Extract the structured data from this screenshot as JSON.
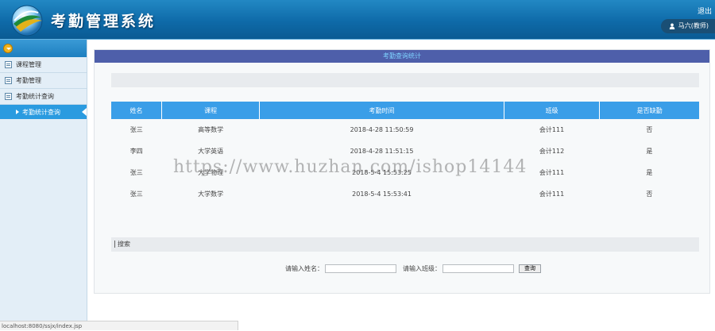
{
  "header": {
    "title": "考勤管理系统",
    "logout_label": "退出",
    "user_label": "马六(教师)"
  },
  "sidebar": {
    "items": [
      {
        "label": "课程管理"
      },
      {
        "label": "考勤管理"
      },
      {
        "label": "考勤统计查询"
      }
    ],
    "active_subitem": "考勤统计查询"
  },
  "panel": {
    "title": "考勤查询统计"
  },
  "table": {
    "columns": [
      "姓名",
      "课程",
      "考勤时间",
      "班级",
      "是否缺勤"
    ],
    "rows": [
      [
        "张三",
        "高等数学",
        "2018-4-28 11:50:59",
        "会计111",
        "否"
      ],
      [
        "李四",
        "大学英语",
        "2018-4-28 11:51:15",
        "会计112",
        "是"
      ],
      [
        "张三",
        "大学物理",
        "2018-5-4 15:53:25",
        "会计111",
        "是"
      ],
      [
        "张三",
        "大学数学",
        "2018-5-4 15:53:41",
        "会计111",
        "否"
      ]
    ]
  },
  "search": {
    "section_label": "搜索",
    "name_label": "请输入姓名：",
    "class_label": "请输入班级：",
    "name_value": "",
    "class_value": "",
    "query_button": "查询"
  },
  "watermark": "https://www.huzhan.com/ishop14144",
  "statusbar": "localhost:8080/ssjx/index.jsp",
  "colors": {
    "header": "#0e6aa8",
    "panel_title_bg": "#4e5faa",
    "table_header": "#3a9ee8",
    "active_menu": "#2a9be0"
  }
}
